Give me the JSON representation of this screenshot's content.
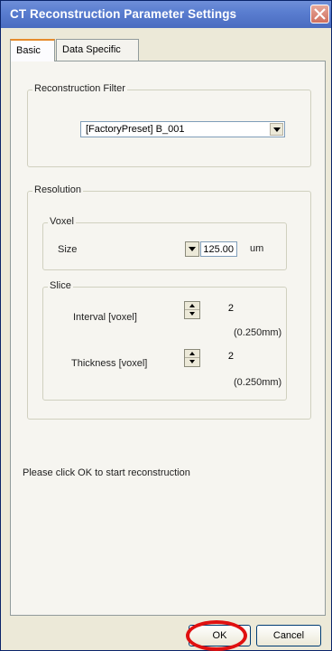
{
  "window": {
    "title": "CT Reconstruction Parameter Settings"
  },
  "tabs": [
    {
      "label": "Basic",
      "active": true
    },
    {
      "label": "Data Specific",
      "active": false
    }
  ],
  "reconstruction_filter": {
    "legend": "Reconstruction Filter",
    "selected": "[FactoryPreset] B_001"
  },
  "resolution": {
    "legend": "Resolution",
    "voxel": {
      "legend": "Voxel",
      "size_label": "Size",
      "size_value": "125.00",
      "size_unit": "um"
    },
    "slice": {
      "legend": "Slice",
      "interval_label": "Interval [voxel]",
      "interval_value": "2",
      "interval_mm": "(0.250mm)",
      "thickness_label": "Thickness [voxel]",
      "thickness_value": "2",
      "thickness_mm": "(0.250mm)"
    }
  },
  "message": "Please click OK to start reconstruction",
  "buttons": {
    "ok": "OK",
    "cancel": "Cancel"
  },
  "icons": {
    "close": "close-icon",
    "dropdown": "chevron-down-icon",
    "spin_up": "arrow-up-icon",
    "spin_down": "arrow-down-icon"
  },
  "colors": {
    "titlebar": "#5a7ed0",
    "highlight": "#e01010",
    "active_tab_accent": "#e68b2c"
  }
}
